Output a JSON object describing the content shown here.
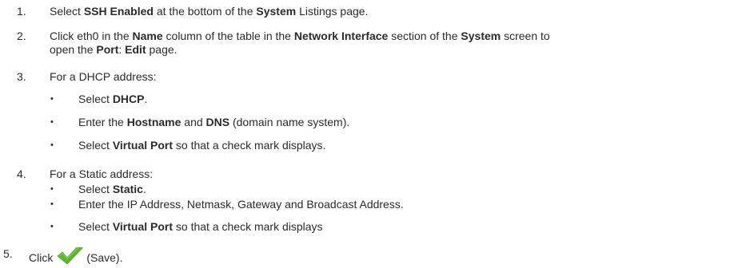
{
  "steps": [
    {
      "number": "1.",
      "parts": [
        "Select ",
        "SSH Enabled",
        " at the bottom of the ",
        "System",
        " Listings page."
      ]
    },
    {
      "number": "2.",
      "parts": [
        "Click eth0 in the ",
        "Name",
        " column of the table in the ",
        "Network Interface",
        " section of the ",
        "System",
        " screen to",
        "open the ",
        "Port",
        ": ",
        "Edit",
        " page."
      ]
    },
    {
      "number": "3.",
      "text": "For a DHCP address:",
      "bullets": [
        {
          "parts": [
            "Select ",
            "DHCP",
            "."
          ]
        },
        {
          "parts": [
            "Enter the ",
            "Hostname",
            " and ",
            "DNS",
            " (domain name system)."
          ]
        },
        {
          "parts": [
            "Select ",
            "Virtual Port",
            " so that a check mark displays."
          ]
        }
      ]
    },
    {
      "number": "4.",
      "text": "For a Static address:",
      "bullets": [
        {
          "parts": [
            "Select ",
            "Static",
            "."
          ]
        },
        {
          "parts": [
            "Enter the IP Address, Netmask, Gateway and Broadcast Address."
          ]
        },
        {
          "parts": [
            "Select ",
            "Virtual Port",
            " so that a check mark displays"
          ]
        }
      ]
    },
    {
      "number": "5.",
      "parts": [
        "Click",
        "(Save)."
      ],
      "icon": "save-checkmark-icon"
    }
  ],
  "bullet_char": "•",
  "colors": {
    "text": "#2b2b2b",
    "check": "#5cb82e"
  }
}
